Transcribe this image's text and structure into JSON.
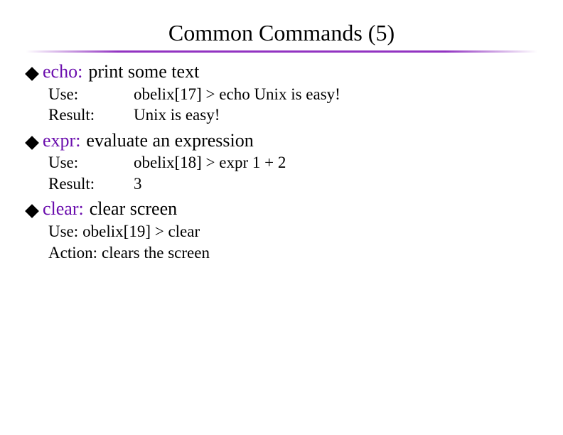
{
  "title": "Common Commands (5)",
  "items": [
    {
      "cmd": "echo:",
      "desc": "print some text",
      "rows": [
        {
          "label": "Use:",
          "value": "obelix[17] > echo Unix is easy!"
        },
        {
          "label": "Result:",
          "value": "Unix is easy!"
        }
      ]
    },
    {
      "cmd": "expr:",
      "desc": "evaluate an expression",
      "rows": [
        {
          "label": "Use:",
          "value": "obelix[18] > expr 1 + 2"
        },
        {
          "label": "Result:",
          "value": "3"
        }
      ]
    },
    {
      "cmd": "clear:",
      "desc": "clear screen",
      "lines": [
        {
          "label": "Use:",
          "value": "obelix[19] > clear"
        },
        {
          "label": "Action:",
          "value": "clears the screen"
        }
      ]
    }
  ]
}
